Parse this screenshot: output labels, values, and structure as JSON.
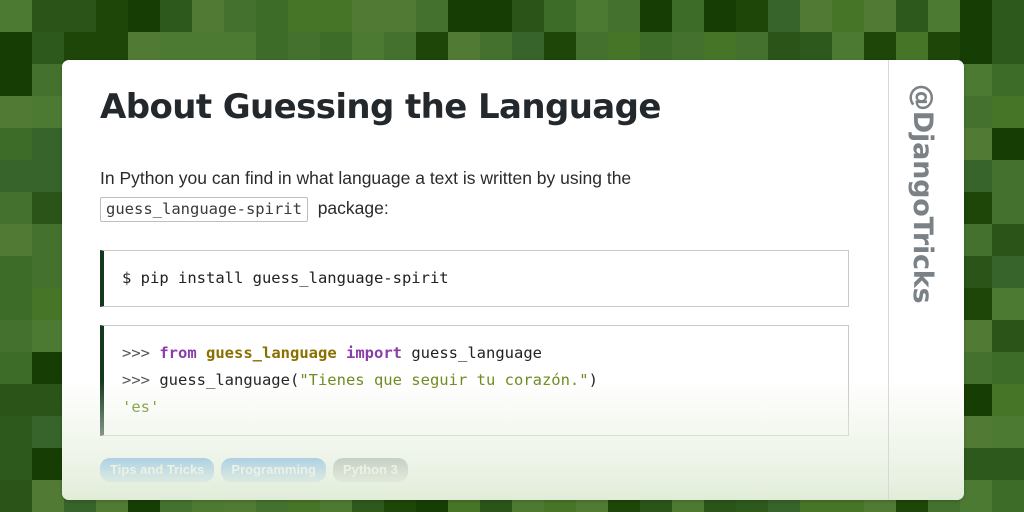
{
  "background": {
    "style": "pixel-grid",
    "cell_size": 32,
    "palette": [
      "#163d04",
      "#2d5a1c",
      "#36642a",
      "#3d6b28",
      "#44722e",
      "#477527",
      "#4c7a33",
      "#517a35",
      "#2a5418",
      "#1d4608"
    ]
  },
  "card": {
    "background_color": "#ffffff",
    "divider_color": "#d8d8d8"
  },
  "header": {
    "title": "About Guessing the Language"
  },
  "body": {
    "lead_prefix": "In Python you can find in what language a text is written by using the",
    "inline_code": "guess_language-spirit",
    "lead_suffix": "package:"
  },
  "code_blocks": [
    {
      "name": "shell-install",
      "language": "bash",
      "accent_color": "#14371f",
      "lines": [
        {
          "tokens": [
            {
              "t": "$ pip install guess_language-spirit",
              "c": "plain"
            }
          ]
        }
      ],
      "plain_text": "$ pip install guess_language-spirit"
    },
    {
      "name": "python-repl",
      "language": "python",
      "accent_color": "#14371f",
      "lines": [
        {
          "tokens": [
            {
              "t": ">>> ",
              "c": "prompt"
            },
            {
              "t": "from",
              "c": "keyword"
            },
            {
              "t": " ",
              "c": "plain"
            },
            {
              "t": "guess_language",
              "c": "module"
            },
            {
              "t": " ",
              "c": "plain"
            },
            {
              "t": "import",
              "c": "keyword"
            },
            {
              "t": " guess_language",
              "c": "plain"
            }
          ]
        },
        {
          "tokens": [
            {
              "t": ">>> ",
              "c": "prompt"
            },
            {
              "t": "guess_language(",
              "c": "plain"
            },
            {
              "t": "\"Tienes que seguir tu corazón.\"",
              "c": "string"
            },
            {
              "t": ")",
              "c": "plain"
            }
          ]
        },
        {
          "tokens": [
            {
              "t": "'es'",
              "c": "string"
            }
          ]
        }
      ],
      "plain_text": ">>> from guess_language import guess_language\n>>> guess_language(\"Tienes que seguir tu corazón.\")\n'es'"
    }
  ],
  "tags": [
    {
      "label": "Tips and Tricks",
      "color": "#147bf0",
      "style": "blue"
    },
    {
      "label": "Programming",
      "color": "#147bf0",
      "style": "blue"
    },
    {
      "label": "Python 3",
      "color": "#6c757d",
      "style": "gray"
    }
  ],
  "watermark": {
    "text": "@DjangoTricks",
    "color": "#7b8287"
  },
  "token_colors": {
    "prompt": "#555555",
    "keyword": "#8a3ea8",
    "module": "#8a7000",
    "string": "#6e8b1e",
    "plain": "#222222"
  }
}
